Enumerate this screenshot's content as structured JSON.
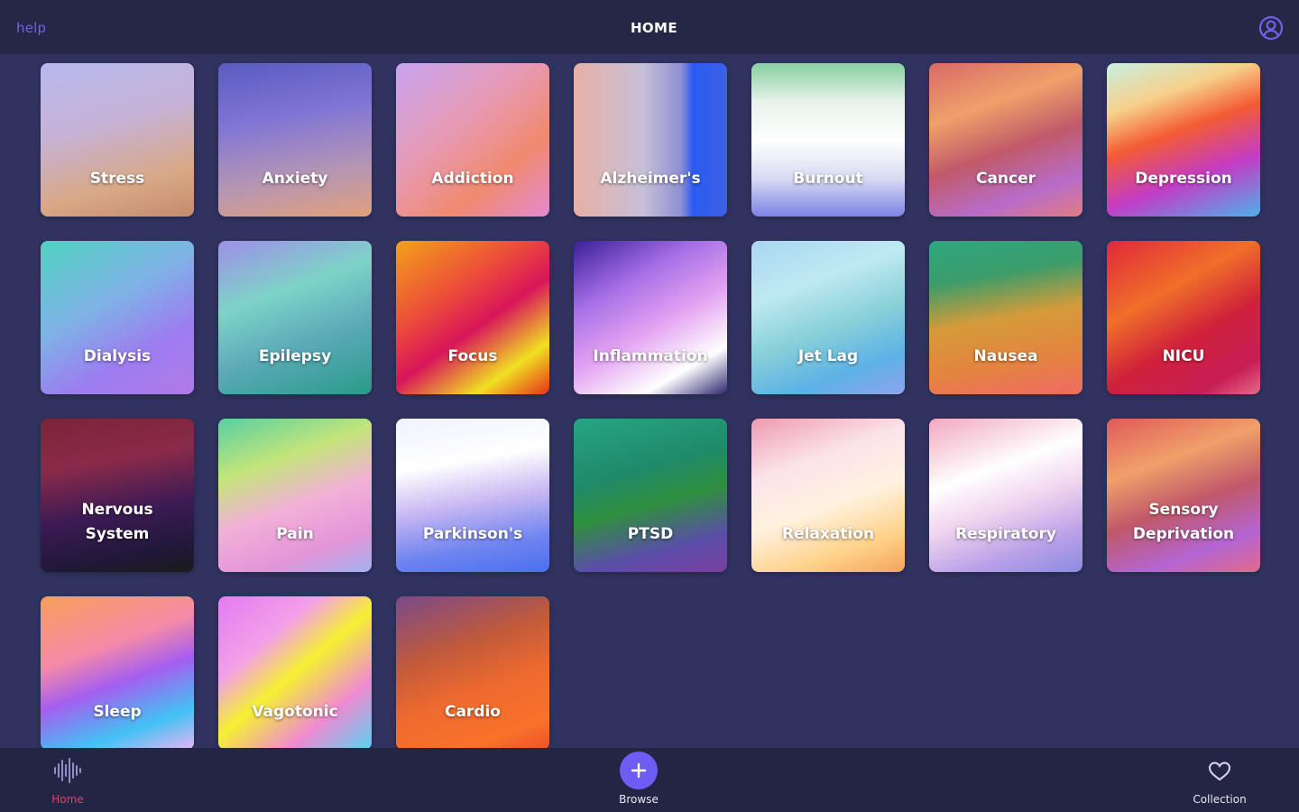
{
  "header": {
    "help_label": "help",
    "title": "HOME",
    "account_icon": "user-circle-icon"
  },
  "tiles": [
    {
      "label": "Stress",
      "bg": "linear-gradient(165deg, #b7b9ee 0%, #c6b2d6 40%, #d9a885 75%, #c48a6f 100%)"
    },
    {
      "label": "Anxiety",
      "bg": "linear-gradient(170deg, #5a5bc0 0%, #7f74d6 35%, #b495b5 70%, #e1a07c 100%)"
    },
    {
      "label": "Addiction",
      "bg": "linear-gradient(140deg, #c7a4f0 0%, #e79ab4 40%, #f08a6f 70%, #e48ad0 100%)"
    },
    {
      "label": "Alzheimer's",
      "bg": "linear-gradient(90deg, #e7b0a6 0%, #c7c0d8 45%, #8f8fd3 70%, #2a5af0 78%, #3c62e6 100%)"
    },
    {
      "label": "Burnout",
      "bg": "linear-gradient(180deg, #86cfa0 0%, #e7f3ea 25%, #ffffff 50%, #d8dcf3 75%, #7d83e4 100%)"
    },
    {
      "label": "Cancer",
      "bg": "linear-gradient(160deg, #d86a6a 0%, #f0a06a 30%, #c05a6a 55%, #b86cc8 80%, #e07c82 100%)"
    },
    {
      "label": "Depression",
      "bg": "linear-gradient(160deg, #c8f0e0 0%, #f7d08a 25%, #f45b34 45%, #c33cc5 70%, #4fb0e8 100%)"
    },
    {
      "label": "Dialysis",
      "bg": "linear-gradient(150deg, #4fd3c0 0%, #7fb3e6 40%, #9c7df0 70%, #b27ae8 100%)"
    },
    {
      "label": "Epilepsy",
      "bg": "linear-gradient(160deg, #9e8fe8 0%, #7ed3c8 35%, #5aa9b7 65%, #2a9b88 100%)"
    },
    {
      "label": "Focus",
      "bg": "linear-gradient(145deg, #f3a11a 0%, #ec4b3a 35%, #d8155a 55%, #f0e022 80%, #e5321a 100%)"
    },
    {
      "label": "Inflammation",
      "bg": "linear-gradient(150deg, #3a1f9a 0%, #a76fe6 30%, #e3a3f2 55%, #ffffff 80%, #2d2570 100%)"
    },
    {
      "label": "Jet Lag",
      "bg": "linear-gradient(160deg, #a8d7f0 0%, #bfe9f2 30%, #8ad1d8 55%, #5db1e6 80%, #8fa3ef 100%)"
    },
    {
      "label": "Nausea",
      "bg": "linear-gradient(170deg, #2ea782 0%, #3c9c6a 25%, #d59b3a 50%, #e3853f 75%, #f06a64 100%)"
    },
    {
      "label": "NICU",
      "bg": "linear-gradient(150deg, #e0283a 0%, #f06f2a 35%, #d0213a 60%, #c81e57 85%, #e86a8a 100%)"
    },
    {
      "label": "Nervous\nSystem",
      "bg": "linear-gradient(170deg, #7a2438 0%, #8a2a4a 30%, #3c1a54 60%, #201838 85%, #1a1a1a 100%)"
    },
    {
      "label": "Pain",
      "bg": "linear-gradient(160deg, #57d0a2 0%, #c4e57a 30%, #f2b0d8 55%, #e395d8 80%, #a0b2f0 100%)"
    },
    {
      "label": "Parkinson's",
      "bg": "linear-gradient(170deg, #f0f2ff 0%, #ffffff 30%, #c6b6f2 55%, #6e84f0 80%, #4b6ff0 100%)"
    },
    {
      "label": "PTSD",
      "bg": "linear-gradient(165deg, #27a583 0%, #1f8a6a 35%, #2f8f3f 55%, #5a4ea8 80%, #7a3fa0 100%)"
    },
    {
      "label": "Relaxation",
      "bg": "linear-gradient(160deg, #ee9ab0 0%, #fbe3ea 30%, #fff2e0 55%, #ffd28a 80%, #f4a35a 100%)"
    },
    {
      "label": "Respiratory",
      "bg": "linear-gradient(160deg, #f0a8c0 0%, #ffffff 35%, #f2d6ef 55%, #b9a0e8 80%, #8a8ce0 100%)"
    },
    {
      "label": "Sensory\nDeprivation",
      "bg": "linear-gradient(160deg, #e05a5a 0%, #f0a06a 30%, #c0586a 55%, #b465d2 80%, #e26a8a 100%)"
    },
    {
      "label": "Sleep",
      "bg": "linear-gradient(160deg, #f5a05a 0%, #f58aa8 35%, #a55ef0 55%, #42c2f4 80%, #e8b4f4 100%)"
    },
    {
      "label": "Vagotonic",
      "bg": "linear-gradient(140deg, #e27bf2 0%, #f3a0e8 30%, #f6f032 50%, #ef8ad2 75%, #57d3f0 100%)"
    },
    {
      "label": "Cardio",
      "bg": "linear-gradient(160deg, #7a4a8a 0%, #c15a3a 35%, #ef6a2f 60%, #f8722a 85%, #ef4f2a 100%)"
    }
  ],
  "bottom_nav": {
    "home": {
      "label": "Home",
      "icon": "waveform-icon",
      "active": true,
      "color": "#e53e6b"
    },
    "browse": {
      "label": "Browse",
      "icon": "plus-icon",
      "color": "#6c5ef5"
    },
    "collection": {
      "label": "Collection",
      "icon": "heart-icon"
    }
  }
}
